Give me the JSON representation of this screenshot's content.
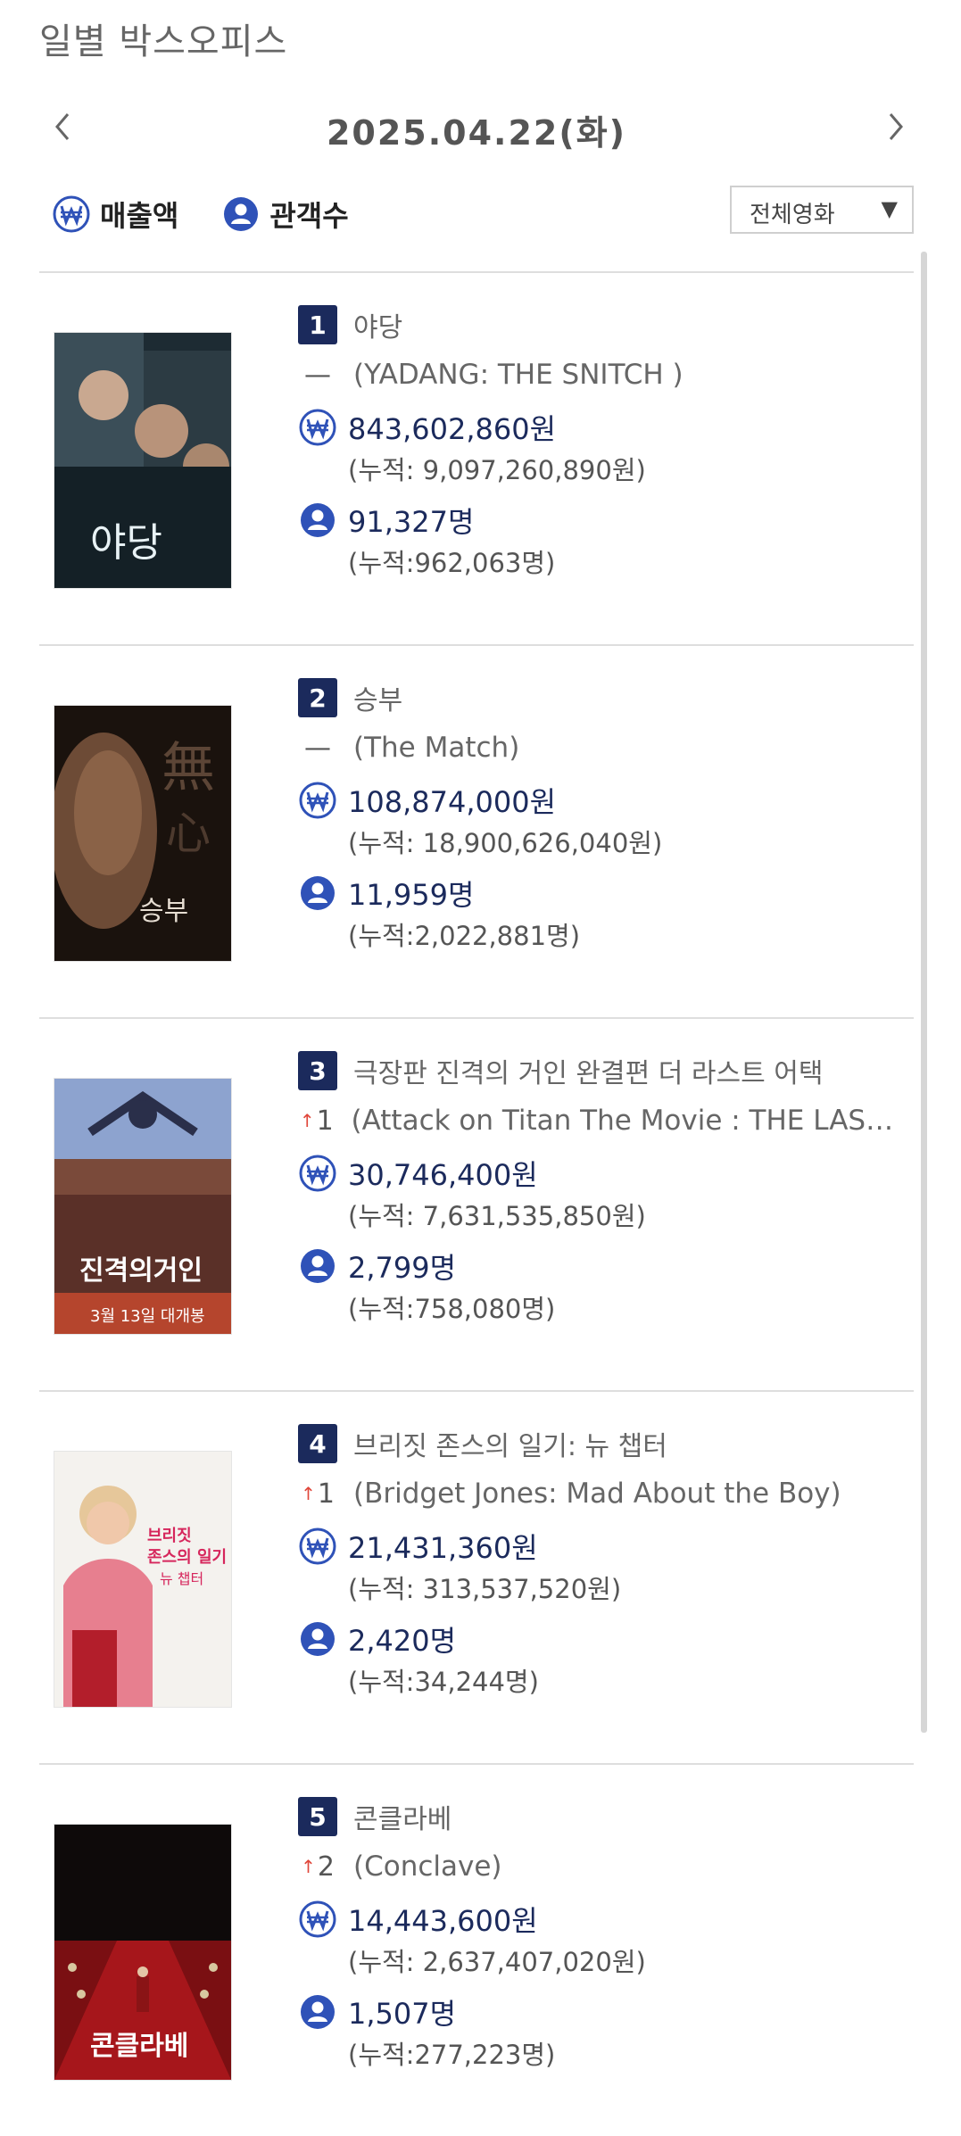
{
  "page": {
    "title": "일별 박스오피스"
  },
  "date_nav": {
    "date": "2025.04.22(화)",
    "prev_label": "<",
    "next_label": ">"
  },
  "toggles": {
    "sales_label": "매출액",
    "audience_label": "관객수"
  },
  "filter": {
    "selected": "전체영화",
    "arrow": "▼"
  },
  "colors": {
    "badge": "#1b2a5c",
    "up_arrow": "#e0463a",
    "icon": "#2f52b8"
  },
  "movies": [
    {
      "rank": "1",
      "title_ko": "야당",
      "change": "—",
      "change_dir": "none",
      "title_en": "(YADANG: THE SNITCH )",
      "sales": "843,602,860원",
      "sales_cum": "(누적: 9,097,260,890원)",
      "audience": "91,327명",
      "audience_cum": "(누적:962,063명)"
    },
    {
      "rank": "2",
      "title_ko": "승부",
      "change": "—",
      "change_dir": "none",
      "title_en": "(The Match)",
      "sales": "108,874,000원",
      "sales_cum": "(누적: 18,900,626,040원)",
      "audience": "11,959명",
      "audience_cum": "(누적:2,022,881명)"
    },
    {
      "rank": "3",
      "title_ko": "극장판 진격의 거인 완결편 더 라스트 어택",
      "change": "1",
      "change_dir": "up",
      "title_en": "(Attack on Titan The Movie : THE LAST A…",
      "sales": "30,746,400원",
      "sales_cum": "(누적: 7,631,535,850원)",
      "audience": "2,799명",
      "audience_cum": "(누적:758,080명)"
    },
    {
      "rank": "4",
      "title_ko": "브리짓 존스의 일기: 뉴 챕터",
      "change": "1",
      "change_dir": "up",
      "title_en": "(Bridget Jones: Mad About the Boy)",
      "sales": "21,431,360원",
      "sales_cum": "(누적: 313,537,520원)",
      "audience": "2,420명",
      "audience_cum": "(누적:34,244명)"
    },
    {
      "rank": "5",
      "title_ko": "콘클라베",
      "change": "2",
      "change_dir": "up",
      "title_en": "(Conclave)",
      "sales": "14,443,600원",
      "sales_cum": "(누적: 2,637,407,020원)",
      "audience": "1,507명",
      "audience_cum": "(누적:277,223명)"
    }
  ]
}
